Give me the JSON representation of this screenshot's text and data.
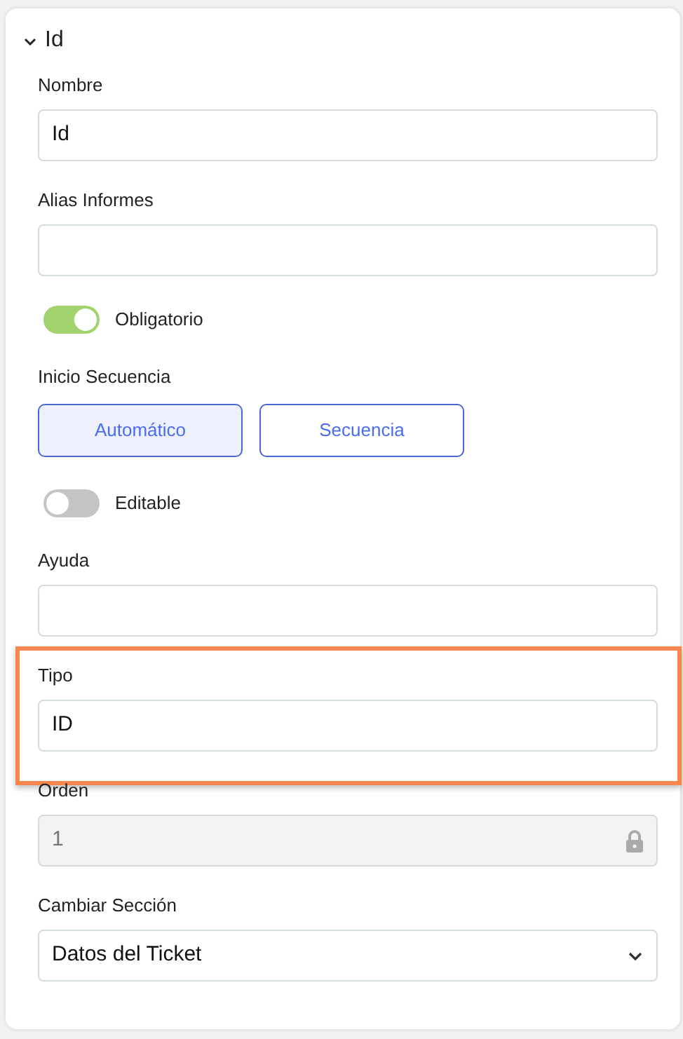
{
  "section": {
    "title": "Id",
    "expanded": true
  },
  "fields": [
    {
      "kind": "text",
      "label": "Nombre",
      "value": "Id"
    },
    {
      "kind": "text",
      "label": "Alias Informes"
    },
    {
      "kind": "toggle",
      "label": "Obligatorio",
      "on": true
    },
    {
      "kind": "segmented",
      "label": "Inicio Secuencia",
      "options": [
        {
          "label": "Automático",
          "selected": true
        },
        {
          "label": "Secuencia",
          "selected": false
        }
      ]
    },
    {
      "kind": "toggle",
      "label": "Editable",
      "on": false
    },
    {
      "kind": "text",
      "label": "Ayuda"
    },
    {
      "kind": "text",
      "label": "Tipo",
      "value": "ID",
      "highlighted": true
    },
    {
      "kind": "text",
      "label": "Orden",
      "value": "1",
      "disabled": true
    },
    {
      "kind": "select",
      "label": "Cambiar Sección",
      "value": "Datos del Ticket"
    }
  ]
}
